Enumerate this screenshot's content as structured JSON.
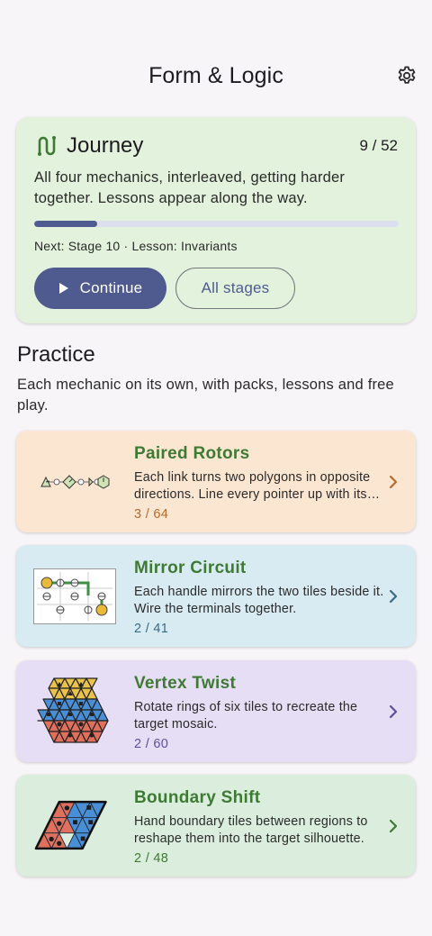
{
  "app": {
    "title": "Form & Logic"
  },
  "journey": {
    "title": "Journey",
    "count": "9 / 52",
    "progress_fraction": 0.173,
    "description": "All four mechanics, interleaved, getting harder together. Lessons appear along the way.",
    "next": "Next: Stage 10 · Lesson: Invariants",
    "continue_label": "Continue",
    "all_stages_label": "All stages"
  },
  "practice": {
    "title": "Practice",
    "description": "Each mechanic on its own, with packs, lessons and free play.",
    "mechanics": [
      {
        "name": "Paired Rotors",
        "description": "Each link turns two polygons in opposite directions. Line every pointer up with its target.",
        "progress": "3 / 64",
        "bg": "#fbe6d2",
        "accent": "#b86a2c"
      },
      {
        "name": "Mirror Circuit",
        "description": "Each handle mirrors the two tiles beside it. Wire the terminals together.",
        "progress": "2 / 41",
        "bg": "#d8ebf3",
        "accent": "#3b6a85"
      },
      {
        "name": "Vertex Twist",
        "description": "Rotate rings of six tiles to recreate the target mosaic.",
        "progress": "2 / 60",
        "bg": "#e6def5",
        "accent": "#5d4f99"
      },
      {
        "name": "Boundary Shift",
        "description": "Hand boundary tiles between regions to reshape them into the target silhouette.",
        "progress": "2 / 48",
        "bg": "#dbeedd",
        "accent": "#3f7a34"
      }
    ]
  },
  "colors": {
    "primary": "#4f5a8f",
    "title_green": "#3f7a34",
    "tri_yellow": "#e9c24b",
    "tri_blue": "#4a8fd6",
    "tri_red": "#e0705e"
  },
  "icons": {
    "settings": "gear-icon",
    "journey": "route-icon",
    "continue": "play-icon",
    "chevron": "chevron-right-icon"
  }
}
